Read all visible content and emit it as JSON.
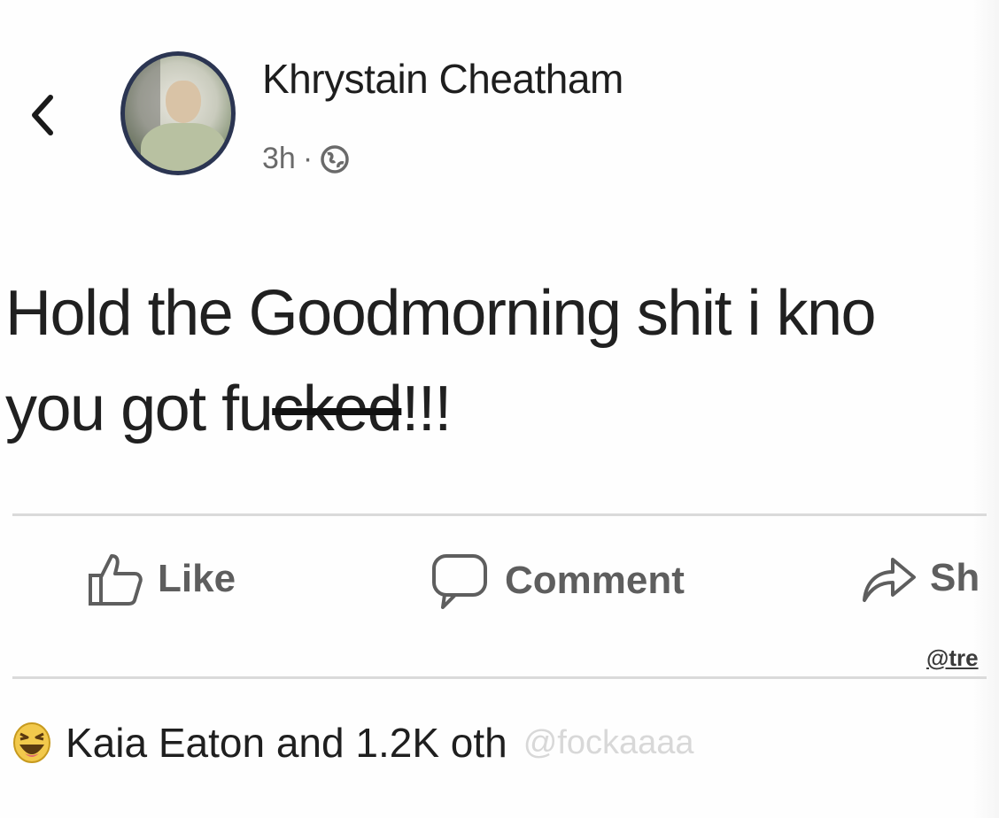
{
  "header": {
    "author_name": "Khrystain Cheatham",
    "timestamp": "3h",
    "separator": "·",
    "privacy_icon": "globe-icon"
  },
  "post": {
    "line1": "Hold the Goodmorning shit i kno",
    "line2_prefix": "you got fu",
    "line2_struck": "cked",
    "line2_suffix": "!!!"
  },
  "actions": {
    "like_label": "Like",
    "comment_label": "Comment",
    "share_label": "Sh",
    "watermark": "@tre"
  },
  "reactions": {
    "icon": "haha-icon",
    "summary": "Kaia Eaton and 1.2K oth",
    "watermark": "@fockaaaa"
  },
  "colors": {
    "avatar_ring": "#2b3552",
    "action_text": "#5e5e5e",
    "divider": "#dadada"
  }
}
